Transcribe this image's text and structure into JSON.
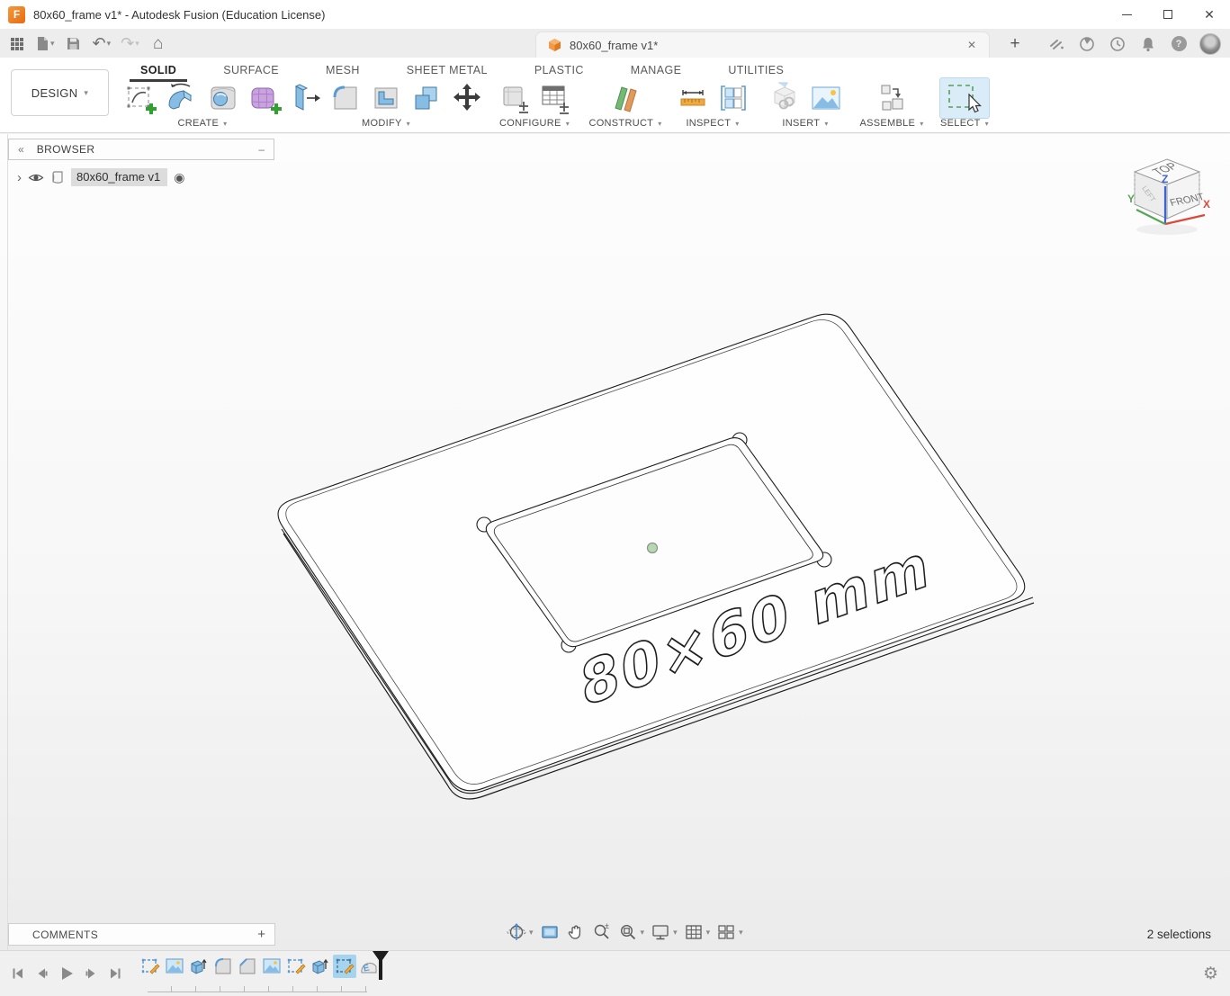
{
  "window": {
    "title": "80x60_frame v1* - Autodesk Fusion (Education License)",
    "app_badge": "F"
  },
  "document_tab": {
    "label": "80x60_frame v1*"
  },
  "ribbon": {
    "design_button": {
      "label": "DESIGN"
    },
    "tabs": [
      {
        "label": "SOLID",
        "active": true
      },
      {
        "label": "SURFACE"
      },
      {
        "label": "MESH"
      },
      {
        "label": "SHEET METAL"
      },
      {
        "label": "PLASTIC"
      },
      {
        "label": "MANAGE"
      },
      {
        "label": "UTILITIES"
      }
    ],
    "panels": [
      {
        "label": "CREATE"
      },
      {
        "label": "MODIFY"
      },
      {
        "label": "CONFIGURE"
      },
      {
        "label": "CONSTRUCT"
      },
      {
        "label": "INSPECT"
      },
      {
        "label": "INSERT"
      },
      {
        "label": "ASSEMBLE"
      },
      {
        "label": "SELECT"
      }
    ]
  },
  "browser": {
    "title": "BROWSER",
    "item": "80x60_frame v1"
  },
  "viewcube": {
    "top": "TOP",
    "front": "FRONT",
    "left": "LEFT",
    "axis_x": "X",
    "axis_y": "Y",
    "axis_z": "Z"
  },
  "model": {
    "engraving": "80×60 mm"
  },
  "comments": {
    "title": "COMMENTS"
  },
  "status": {
    "selections": "2 selections"
  },
  "timeline": {
    "features": [
      "sketch",
      "canvas",
      "extrude",
      "fillet",
      "chamfer",
      "canvas",
      "sketch",
      "extrude",
      "sketch",
      "emboss"
    ],
    "selected_index": 8
  },
  "colors": {
    "accent_orange": "#ef8a1d",
    "select_highlight": "#d9ecf8",
    "timeline_selected": "#a6d4ef",
    "axis_x": "#d94a3a",
    "axis_y": "#57a557",
    "axis_z": "#3b62d9"
  },
  "glyphs": {
    "caret_down": "▾",
    "chevron_right": "›",
    "collapse_left": "«",
    "panel_minimize": "–",
    "plus": "+",
    "close": "✕",
    "undo": "↶",
    "redo": "↷",
    "home": "⌂",
    "question": "?",
    "gear": "⚙",
    "activate_target": "◉",
    "window_minimize": "–"
  }
}
